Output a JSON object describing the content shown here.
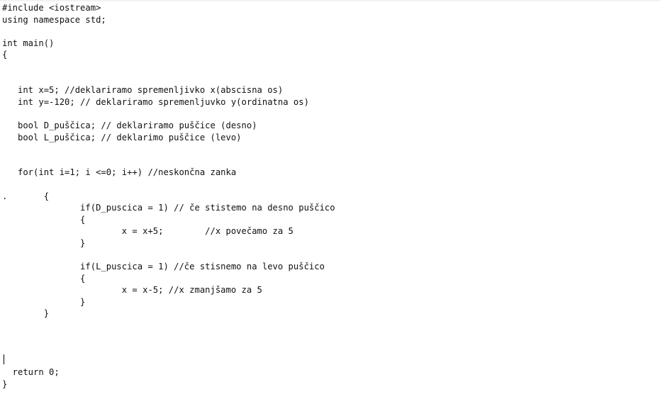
{
  "editor": {
    "lines": [
      "#include <iostream>",
      "using namespace std;",
      "",
      "int main()",
      "{",
      "",
      "",
      "   int x=5; //deklariramo spremenljivko x(abscisna os)",
      "   int y=-120; // deklariramo spremenljuvko y(ordinatna os)",
      "",
      "   bool D_puščica; // deklariramo puščice (desno)",
      "   bool L_puščica; // deklarimo puščice (levo)",
      "",
      "",
      "   for(int i=1; i <=0; i++) //neskončna zanka",
      "",
      ".       {",
      "               if(D_puscica = 1) // če stistemo na desno puščico",
      "               {",
      "                       x = x+5;        //x povečamo za 5",
      "               }",
      "",
      "               if(L_puscica = 1) //če stisnemo na levo puščico",
      "               {",
      "                       x = x-5; //x zmanjšamo za 5",
      "               }",
      "        }",
      "",
      "",
      "",
      "",
      "  return 0;",
      "}"
    ]
  }
}
